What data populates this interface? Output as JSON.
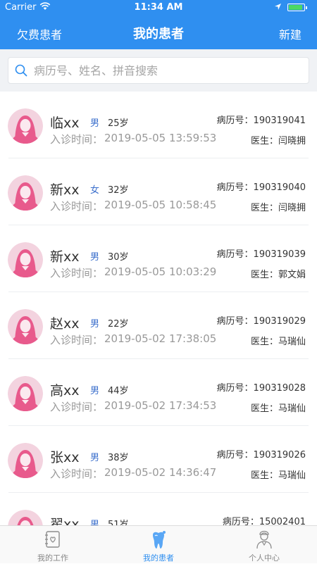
{
  "status_bar": {
    "carrier": "Carrier",
    "time": "11:34 AM"
  },
  "nav": {
    "left": "欠费患者",
    "title": "我的患者",
    "right": "新建"
  },
  "search": {
    "placeholder": "病历号、姓名、拼音搜索",
    "value": ""
  },
  "labels": {
    "visit_time": "入诊时间：",
    "record_no": "病历号：",
    "doctor": "医生："
  },
  "colors": {
    "accent": "#2f8ff0",
    "gender": "#3b6fcc",
    "avatar": "#e85a8c"
  },
  "patients": [
    {
      "name": "临xx",
      "gender": "男",
      "age": "25岁",
      "visit_time": "2019-05-05 13:59:53",
      "record_no": "190319041",
      "doctor": "闫晓拥"
    },
    {
      "name": "新xx",
      "gender": "女",
      "age": "32岁",
      "visit_time": "2019-05-05 10:58:45",
      "record_no": "190319040",
      "doctor": "闫晓拥"
    },
    {
      "name": "新xx",
      "gender": "男",
      "age": "30岁",
      "visit_time": "2019-05-05 10:03:29",
      "record_no": "190319039",
      "doctor": "郭文娟"
    },
    {
      "name": "赵xx",
      "gender": "男",
      "age": "22岁",
      "visit_time": "2019-05-02 17:38:05",
      "record_no": "190319029",
      "doctor": "马瑞仙"
    },
    {
      "name": "高xx",
      "gender": "男",
      "age": "44岁",
      "visit_time": "2019-05-02 17:34:53",
      "record_no": "190319028",
      "doctor": "马瑞仙"
    },
    {
      "name": "张xx",
      "gender": "男",
      "age": "38岁",
      "visit_time": "2019-05-02 14:36:47",
      "record_no": "190319026",
      "doctor": "马瑞仙"
    },
    {
      "name": "翟xx",
      "gender": "男",
      "age": "51岁",
      "visit_time": "",
      "record_no": "15002401",
      "doctor": ""
    }
  ],
  "tabs": [
    {
      "label": "我的工作",
      "icon": "work-icon",
      "active": false
    },
    {
      "label": "我的患者",
      "icon": "tooth-icon",
      "active": true
    },
    {
      "label": "个人中心",
      "icon": "person-icon",
      "active": false
    }
  ]
}
